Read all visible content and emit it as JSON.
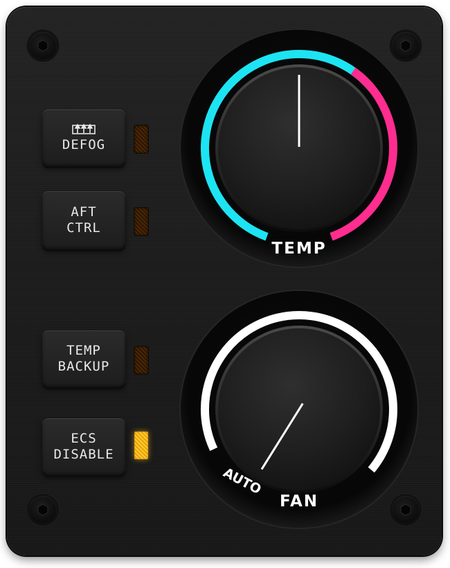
{
  "buttons": {
    "defog": {
      "label": "DEFOG",
      "icon": "defog-icon",
      "indicator_on": false
    },
    "aft_ctrl": {
      "line1": "AFT",
      "line2": "CTRL",
      "indicator_on": false
    },
    "temp_backup": {
      "line1": "TEMP",
      "line2": "BACKUP",
      "indicator_on": false
    },
    "ecs_disable": {
      "line1": "ECS",
      "line2": "DISABLE",
      "indicator_on": true
    }
  },
  "knobs": {
    "temp": {
      "label": "TEMP",
      "cold_color": "#1de4f2",
      "hot_color": "#ff2d8f",
      "pointer_angle_deg": 0
    },
    "fan": {
      "label": "FAN",
      "auto_label": "AUTO",
      "scale_color": "#ffffff",
      "pointer_angle_deg": 212
    }
  },
  "colors": {
    "panel": "#1e1e1e",
    "indicator_off": "#4a2706",
    "indicator_on": "#ffc21f",
    "text": "#e8e8e8"
  }
}
